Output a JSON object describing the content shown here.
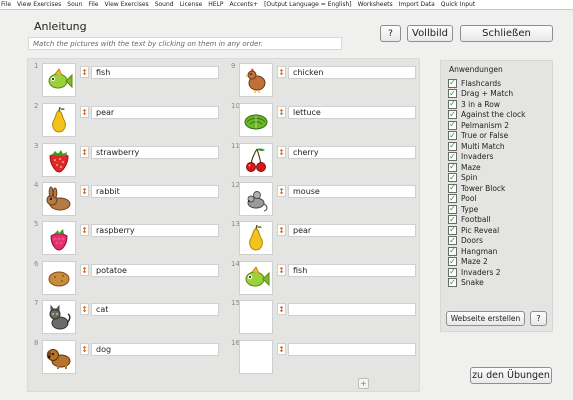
{
  "menu": [
    "File",
    "View Exercises",
    "Soun",
    "File",
    "View Exercises",
    "Sound",
    "License",
    "HELP",
    "Accents+",
    "[Output Language = English]",
    "Worksheets",
    "Import Data",
    "Quick Input"
  ],
  "header": {
    "title": "Anleitung",
    "instruction": "Match the pictures with the text by clicking on them in any order.",
    "help_label": "?",
    "fullscreen_label": "Vollbild",
    "close_label": "Schließen"
  },
  "items": [
    {
      "num": "1",
      "label": "fish",
      "icon": "fish-icon"
    },
    {
      "num": "2",
      "label": "pear",
      "icon": "pear-icon"
    },
    {
      "num": "3",
      "label": "strawberry",
      "icon": "strawberry-icon"
    },
    {
      "num": "4",
      "label": "rabbit",
      "icon": "rabbit-icon"
    },
    {
      "num": "5",
      "label": "raspberry",
      "icon": "raspberry-icon"
    },
    {
      "num": "6",
      "label": "potatoe",
      "icon": "potato-icon"
    },
    {
      "num": "7",
      "label": "cat",
      "icon": "cat-icon"
    },
    {
      "num": "8",
      "label": "dog",
      "icon": "dog-icon"
    },
    {
      "num": "9",
      "label": "chicken",
      "icon": "chicken-icon"
    },
    {
      "num": "10",
      "label": "lettuce",
      "icon": "lettuce-icon"
    },
    {
      "num": "11",
      "label": "cherry",
      "icon": "cherry-icon"
    },
    {
      "num": "12",
      "label": "mouse",
      "icon": "mouse-icon"
    },
    {
      "num": "13",
      "label": "pear",
      "icon": "pear-icon"
    },
    {
      "num": "14",
      "label": "fish",
      "icon": "fish-icon"
    },
    {
      "num": "15",
      "label": "",
      "icon": ""
    },
    {
      "num": "16",
      "label": "",
      "icon": ""
    }
  ],
  "handle_glyph": "↕",
  "add_label": "+",
  "sidebar": {
    "title": "Anwendungen",
    "check_glyph": "✓",
    "apps": [
      "Flashcards",
      "Drag + Match",
      "3 in a Row",
      "Against the clock",
      "Pelmanism 2",
      "True or False",
      "Multi Match",
      "Invaders",
      "Maze",
      "Spin",
      "Tower Block",
      "Pool",
      "Type",
      "Football",
      "Pic Reveal",
      "Doors",
      "Hangman",
      "Maze 2",
      "Invaders 2",
      "Snake"
    ],
    "website_label": "Webseite erstellen",
    "help_label": "?"
  },
  "footer": {
    "back_label": "zu den Übungen"
  }
}
